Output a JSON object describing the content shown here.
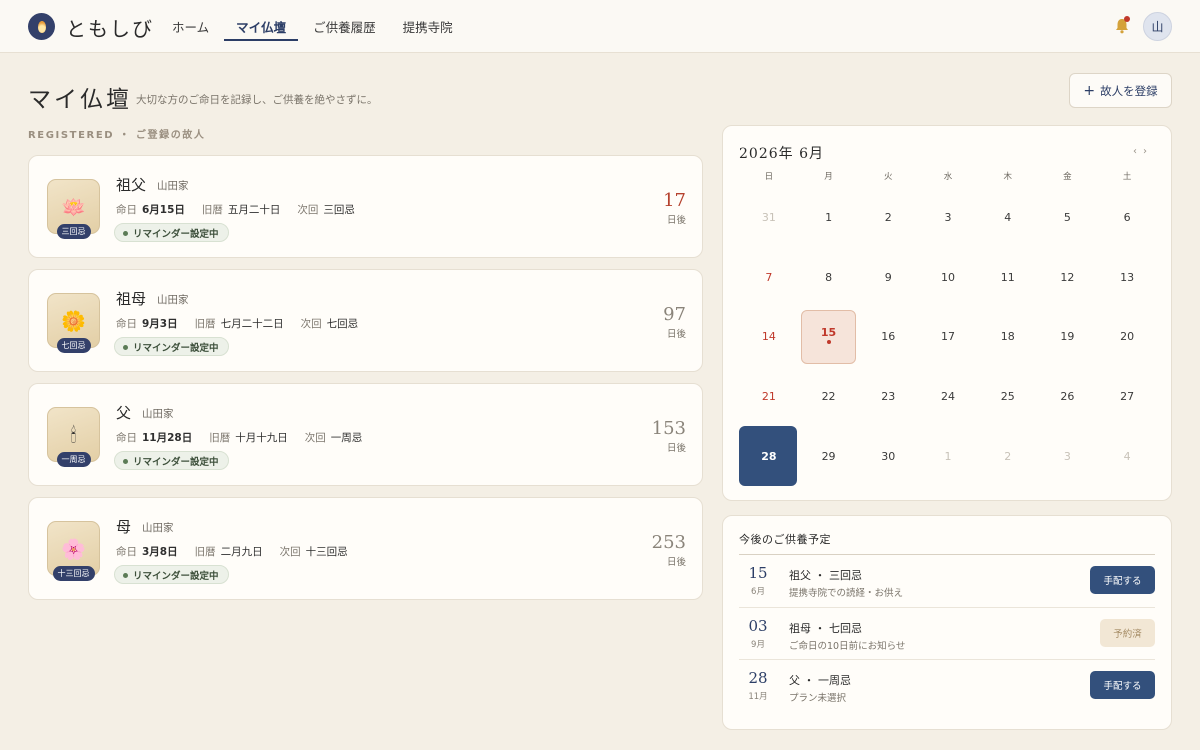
{
  "app": {
    "name": "ともしび"
  },
  "nav": {
    "items": [
      {
        "label": "ホーム"
      },
      {
        "label": "マイ仏壇"
      },
      {
        "label": "ご供養履歴"
      },
      {
        "label": "提携寺院"
      }
    ],
    "active_index": 1
  },
  "user": {
    "avatar_char": "山"
  },
  "page": {
    "title": "マイ仏壇",
    "subtitle": "大切な方のご命日を記録し、ご供養を絶やさずに。",
    "add_button": "故人を登録",
    "section_label": "REGISTERED ・ ご登録の故人"
  },
  "persons": [
    {
      "name": "祖父",
      "family": "山田家",
      "icon": "lotus-icon",
      "glyph": "🪷",
      "badge": "三回忌",
      "meinichi_label": "命日",
      "meinichi": "6月15日",
      "kyureki_label": "旧暦",
      "kyureki": "五月二十日",
      "next_label": "次回",
      "next": "三回忌",
      "reminder": "リマインダー設定中",
      "days": "17",
      "days_unit": "日後",
      "days_color": "#b5412e"
    },
    {
      "name": "祖母",
      "family": "山田家",
      "icon": "sunflower-icon",
      "glyph": "🌼",
      "badge": "七回忌",
      "meinichi_label": "命日",
      "meinichi": "9月3日",
      "kyureki_label": "旧暦",
      "kyureki": "七月二十二日",
      "next_label": "次回",
      "next": "七回忌",
      "reminder": "リマインダー設定中",
      "days": "97",
      "days_unit": "日後",
      "days_color": "#8a847a"
    },
    {
      "name": "父",
      "family": "山田家",
      "icon": "candle-icon",
      "glyph": "🕯",
      "badge": "一周忌",
      "meinichi_label": "命日",
      "meinichi": "11月28日",
      "kyureki_label": "旧暦",
      "kyureki": "十月十九日",
      "next_label": "次回",
      "next": "一周忌",
      "reminder": "リマインダー設定中",
      "days": "153",
      "days_unit": "日後",
      "days_color": "#8a847a"
    },
    {
      "name": "母",
      "family": "山田家",
      "icon": "blossom-icon",
      "glyph": "🌸",
      "badge": "十三回忌",
      "meinichi_label": "命日",
      "meinichi": "3月8日",
      "kyureki_label": "旧暦",
      "kyureki": "二月九日",
      "next_label": "次回",
      "next": "十三回忌",
      "reminder": "リマインダー設定中",
      "days": "253",
      "days_unit": "日後",
      "days_color": "#8a847a"
    }
  ],
  "calendar": {
    "title": "2026年 6月",
    "nav_prev": "‹",
    "nav_next": "›",
    "weekdays": [
      "日",
      "月",
      "火",
      "水",
      "木",
      "金",
      "土"
    ],
    "days": [
      {
        "d": "31",
        "muted": true
      },
      {
        "d": "1"
      },
      {
        "d": "2"
      },
      {
        "d": "3"
      },
      {
        "d": "4"
      },
      {
        "d": "5"
      },
      {
        "d": "6"
      },
      {
        "d": "7",
        "sun": true
      },
      {
        "d": "8"
      },
      {
        "d": "9"
      },
      {
        "d": "10"
      },
      {
        "d": "11"
      },
      {
        "d": "12"
      },
      {
        "d": "13"
      },
      {
        "d": "14",
        "sun": true
      },
      {
        "d": "15",
        "memorial": true
      },
      {
        "d": "16"
      },
      {
        "d": "17"
      },
      {
        "d": "18"
      },
      {
        "d": "19"
      },
      {
        "d": "20"
      },
      {
        "d": "21",
        "sun": true
      },
      {
        "d": "22"
      },
      {
        "d": "23"
      },
      {
        "d": "24"
      },
      {
        "d": "25"
      },
      {
        "d": "26"
      },
      {
        "d": "27"
      },
      {
        "d": "28",
        "today": true
      },
      {
        "d": "29"
      },
      {
        "d": "30"
      },
      {
        "d": "1",
        "muted": true
      },
      {
        "d": "2",
        "muted": true
      },
      {
        "d": "3",
        "muted": true
      },
      {
        "d": "4",
        "muted": true
      }
    ]
  },
  "upcoming": {
    "title": "今後のご供養予定",
    "items": [
      {
        "day": "15",
        "month": "6月",
        "name": "祖父 ・ 三回忌",
        "desc": "提携寺院での読経・お供え",
        "action": "手配する",
        "state": "primary"
      },
      {
        "day": "03",
        "month": "9月",
        "name": "祖母 ・ 七回忌",
        "desc": "ご命日の10日前にお知らせ",
        "action": "予約済",
        "state": "done"
      },
      {
        "day": "28",
        "month": "11月",
        "name": "父 ・ 一周忌",
        "desc": "プラン未選択",
        "action": "手配する",
        "state": "primary"
      }
    ]
  },
  "colors": {
    "primary": "#33507c",
    "accent_red": "#c0392b",
    "background": "#f4efe5"
  }
}
